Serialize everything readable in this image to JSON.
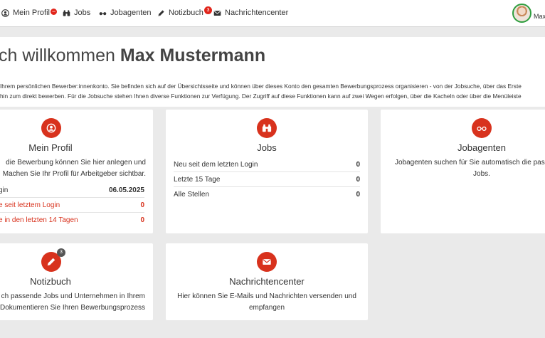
{
  "nav": {
    "items": [
      {
        "label": "Mein Profil",
        "icon": "user-circle-icon",
        "badge": "−"
      },
      {
        "label": "Jobs",
        "icon": "binoculars-icon"
      },
      {
        "label": "Jobagenten",
        "icon": "glasses-icon"
      },
      {
        "label": "Notizbuch",
        "icon": "pencil-icon",
        "badge": "3"
      },
      {
        "label": "Nachrichtencenter",
        "icon": "envelope-icon"
      }
    ],
    "user_short": "Max"
  },
  "hero": {
    "greeting": "ch willkommen ",
    "name": "Max Mustermann",
    "line1": "Ihrem persönlichen Bewerber:innenkonto. Sie befinden sich auf der Übersichtsseite und können über dieses Konto den gesamten Bewerbungsprozess organisieren - von der Jobsuche, über das Erste",
    "line2": "hin zum direkt bewerben. Für die Jobsuche stehen Ihnen diverse Funktionen zur Verfügung. Der Zugriff auf diese Funktionen kann auf zwei Wegen erfolgen, über die Kacheln oder über die Menüleiste"
  },
  "cards": {
    "profil": {
      "title": "Mein Profil",
      "desc1": "die Bewerbung können Sie hier anlegen und",
      "desc2": "Machen Sie Ihr Profil für Arbeitgeber sichtbar.",
      "rows": [
        {
          "label": "gin",
          "value": "06.05.2025"
        },
        {
          "label": "e seit letztem Login",
          "value": "0"
        },
        {
          "label": "e in den letzten 14 Tagen",
          "value": "0"
        }
      ]
    },
    "jobs": {
      "title": "Jobs",
      "rows": [
        {
          "label": "Neu seit dem letzten Login",
          "value": "0"
        },
        {
          "label": "Letzte 15 Tage",
          "value": "0"
        },
        {
          "label": "Alle Stellen",
          "value": "0"
        }
      ]
    },
    "jobagenten": {
      "title": "Jobagenten",
      "desc1": "Jobagenten suchen für Sie automatisch die pass",
      "desc2": "Jobs."
    },
    "notizbuch": {
      "title": "Notizbuch",
      "badge": "3",
      "desc1": "ch passende Jobs und Unternehmen in Ihrem",
      "desc2": "Dokumentieren Sie Ihren Bewerbungsprozess"
    },
    "nachrichten": {
      "title": "Nachrichtencenter",
      "desc1": "Hier können Sie E-Mails und Nachrichten versenden und",
      "desc2": "empfangen"
    }
  },
  "colors": {
    "accent": "#d8321d",
    "avatar_ring": "#2e9e3e",
    "background": "#eaeaea"
  }
}
